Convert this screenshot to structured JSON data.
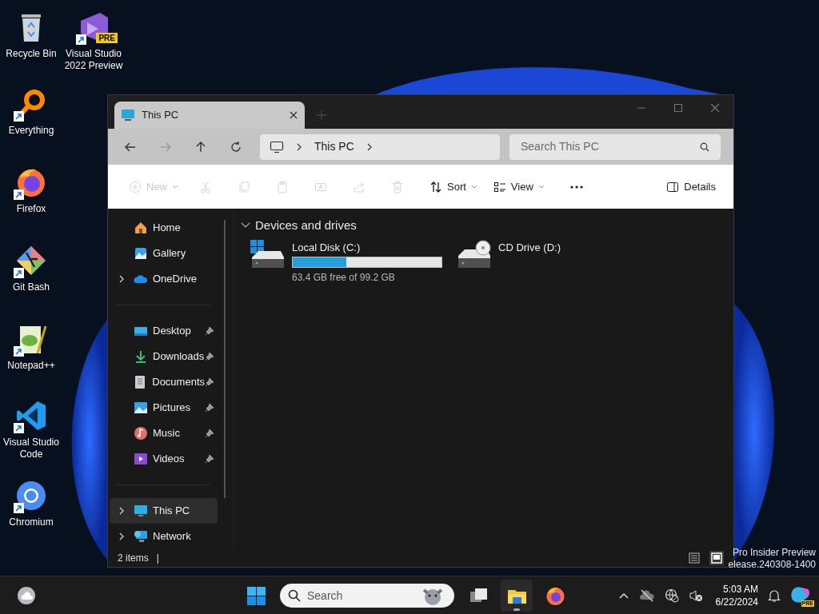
{
  "desktop_icons": [
    {
      "label": "Recycle Bin",
      "shortcut": false
    },
    {
      "label": "Visual Studio 2022 Preview",
      "shortcut": true,
      "badge": "PRE"
    },
    {
      "label": "Everything",
      "shortcut": true
    },
    {
      "label": "Firefox",
      "shortcut": true
    },
    {
      "label": "Git Bash",
      "shortcut": true
    },
    {
      "label": "Notepad++",
      "shortcut": true
    },
    {
      "label": "Visual Studio Code",
      "shortcut": true
    },
    {
      "label": "Chromium",
      "shortcut": true
    }
  ],
  "window": {
    "tab": {
      "title": "This PC"
    },
    "nav": {
      "buttons": [
        {
          "kind": "back",
          "disabled": false
        },
        {
          "kind": "forward",
          "disabled": true
        },
        {
          "kind": "up",
          "disabled": false
        },
        {
          "kind": "refresh",
          "disabled": false
        }
      ],
      "breadcrumb": "This PC",
      "search": {
        "placeholder": "Search This PC"
      }
    },
    "toolbar": [
      {
        "kind": "new",
        "label": "New",
        "disabled": true,
        "dropdown": true
      },
      {
        "kind": "cut",
        "disabled": true
      },
      {
        "kind": "copy",
        "disabled": true
      },
      {
        "kind": "paste",
        "disabled": true
      },
      {
        "kind": "rename",
        "disabled": true
      },
      {
        "kind": "share",
        "disabled": true
      },
      {
        "kind": "delete",
        "disabled": true
      },
      {
        "kind": "sort",
        "label": "Sort",
        "disabled": false,
        "dropdown": true
      },
      {
        "kind": "view",
        "label": "View",
        "disabled": false,
        "dropdown": true
      },
      {
        "kind": "more",
        "disabled": false
      },
      {
        "kind": "details",
        "label": "Details",
        "disabled": false
      }
    ],
    "sidebar": {
      "groups": [
        [
          {
            "kind": "home",
            "label": "Home",
            "expandable": false,
            "pinned": false,
            "selected": false
          },
          {
            "kind": "gallery",
            "label": "Gallery",
            "expandable": false,
            "pinned": false,
            "selected": false
          },
          {
            "kind": "cloud",
            "label": "OneDrive",
            "expandable": true,
            "pinned": false,
            "selected": false
          }
        ],
        [
          {
            "kind": "desktop",
            "label": "Desktop",
            "expandable": false,
            "pinned": true,
            "selected": false
          },
          {
            "kind": "downloads",
            "label": "Downloads",
            "expandable": false,
            "pinned": true,
            "selected": false
          },
          {
            "kind": "documents",
            "label": "Documents",
            "expandable": false,
            "pinned": true,
            "selected": false
          },
          {
            "kind": "pictures",
            "label": "Pictures",
            "expandable": false,
            "pinned": true,
            "selected": false
          },
          {
            "kind": "music",
            "label": "Music",
            "expandable": false,
            "pinned": true,
            "selected": false
          },
          {
            "kind": "videos",
            "label": "Videos",
            "expandable": false,
            "pinned": true,
            "selected": false
          }
        ],
        [
          {
            "kind": "pc",
            "label": "This PC",
            "expandable": true,
            "pinned": false,
            "selected": true
          },
          {
            "kind": "network",
            "label": "Network",
            "expandable": true,
            "pinned": false,
            "selected": false
          }
        ]
      ]
    },
    "section": {
      "title": "Devices and drives",
      "expanded": true
    },
    "drives": [
      {
        "kind": "disk",
        "name": "Local Disk (C:)",
        "level": 0.36,
        "info": "63.4 GB free of 99.2 GB"
      },
      {
        "kind": "cd",
        "name": "CD Drive (D:)"
      }
    ],
    "status_bar": {
      "count": "2 items",
      "separator": "|",
      "views": [
        {
          "kind": "details",
          "selected": false
        },
        {
          "kind": "tiles",
          "selected": true
        }
      ]
    }
  },
  "watermark_lines": [
    "Pro Insider Preview",
    "elease.240308-1400"
  ],
  "taskbar": {
    "search": {
      "placeholder": "Search"
    },
    "apps": [
      {
        "kind": "start",
        "active": false
      },
      {
        "kind": "taskview",
        "active": false
      },
      {
        "kind": "explorer",
        "active": true
      },
      {
        "kind": "firefox",
        "active": false
      }
    ],
    "tray": {
      "time": "5:03 AM",
      "date": "6/22/2024",
      "copilot_badge": "PRE"
    }
  }
}
